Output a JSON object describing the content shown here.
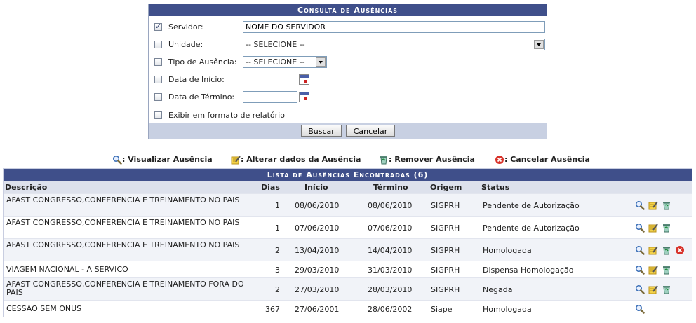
{
  "form": {
    "title": "Consulta de Ausências",
    "servidor_label": "Servidor:",
    "servidor_value": "NOME DO SERVIDOR",
    "unidade_label": "Unidade:",
    "unidade_value": "-- SELECIONE --",
    "tipo_label": "Tipo de Ausência:",
    "tipo_value": "-- SELECIONE --",
    "inicio_label": "Data de Início:",
    "termino_label": "Data de Término:",
    "relatorio_label": "Exibir em formato de relatório",
    "buscar_label": "Buscar",
    "cancelar_label": "Cancelar"
  },
  "legend": {
    "visualizar": ": Visualizar Ausência",
    "alterar": ": Alterar dados da Ausência",
    "remover": ": Remover Ausência",
    "cancelar": ": Cancelar Ausência"
  },
  "list": {
    "title": "Lista de Ausências Encontradas (6)",
    "headers": {
      "descricao": "Descrição",
      "dias": "Dias",
      "inicio": "Início",
      "termino": "Término",
      "origem": "Origem",
      "status": "Status"
    },
    "rows": [
      {
        "descricao": "AFAST CONGRESSO,CONFERENCIA E TREINAMENTO NO PAIS",
        "dias": "1",
        "inicio": "08/06/2010",
        "termino": "08/06/2010",
        "origem": "SIGPRH",
        "status": "Pendente de Autorização"
      },
      {
        "descricao": "AFAST CONGRESSO,CONFERENCIA E TREINAMENTO NO PAIS",
        "dias": "1",
        "inicio": "07/06/2010",
        "termino": "07/06/2010",
        "origem": "SIGPRH",
        "status": "Pendente de Autorização"
      },
      {
        "descricao": "AFAST CONGRESSO,CONFERENCIA E TREINAMENTO NO PAIS",
        "dias": "2",
        "inicio": "13/04/2010",
        "termino": "14/04/2010",
        "origem": "SIGPRH",
        "status": "Homologada"
      },
      {
        "descricao": "VIAGEM NACIONAL - A SERVICO",
        "dias": "3",
        "inicio": "29/03/2010",
        "termino": "31/03/2010",
        "origem": "SIGPRH",
        "status": "Dispensa Homologação"
      },
      {
        "descricao": "AFAST CONGRESSO,CONFERENCIA E TREINAMENTO FORA DO PAIS",
        "dias": "2",
        "inicio": "27/03/2010",
        "termino": "28/03/2010",
        "origem": "SIGPRH",
        "status": "Negada"
      },
      {
        "descricao": "CESSAO SEM ONUS",
        "dias": "367",
        "inicio": "27/06/2001",
        "termino": "28/06/2002",
        "origem": "Siape",
        "status": "Homologada"
      }
    ]
  }
}
